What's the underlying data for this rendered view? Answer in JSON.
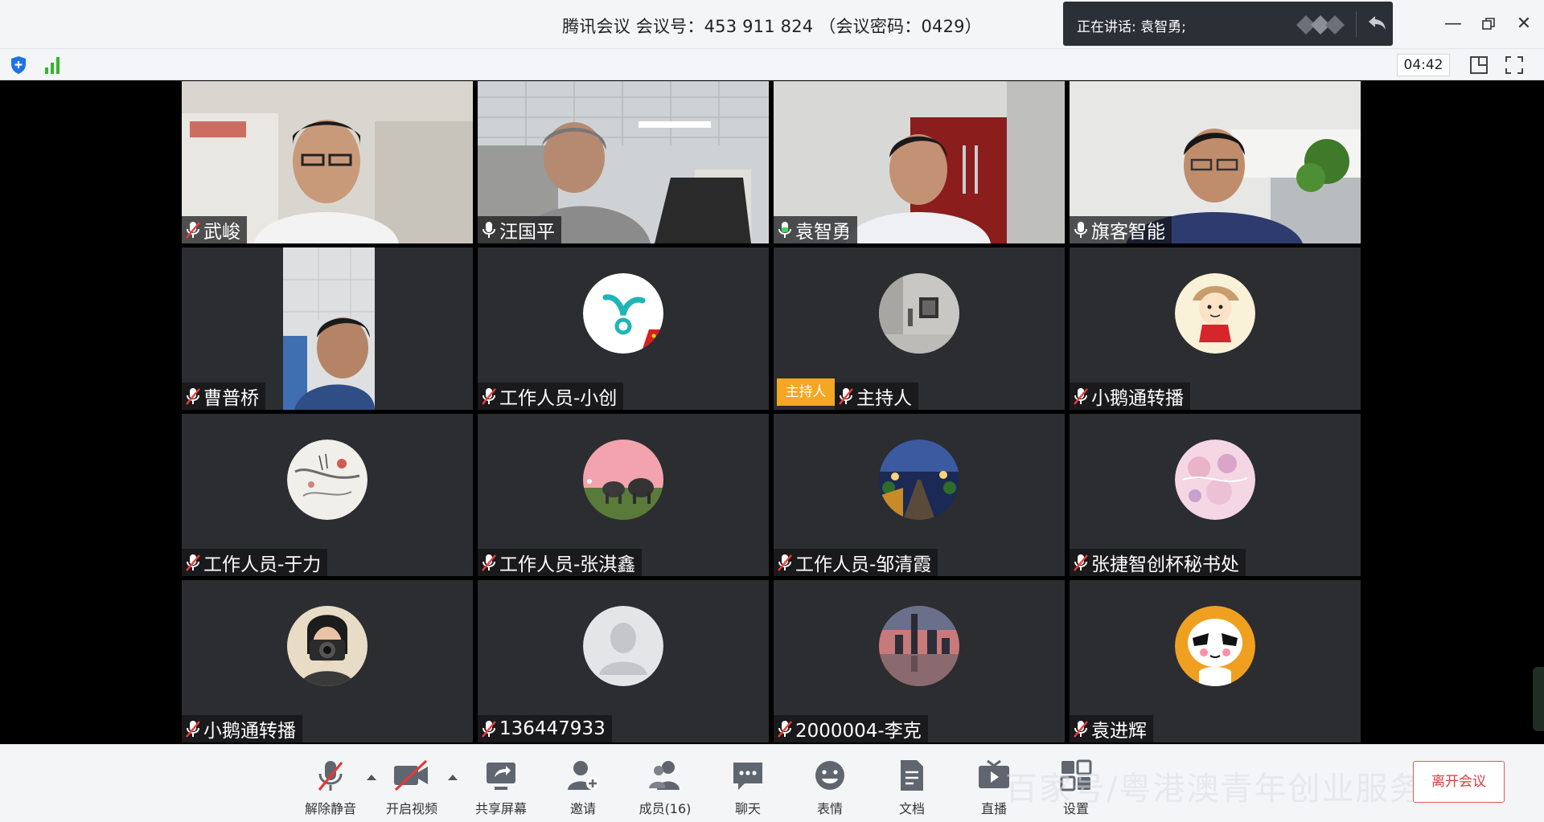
{
  "window": {
    "title": "腾讯会议 会议号：453 911 824  （会议密码：0429）",
    "speaking_label": "正在讲话: 袁智勇;"
  },
  "toolbar": {
    "timer": "04:42"
  },
  "tiles": [
    {
      "name": "武峻",
      "muted": true,
      "kind": "video",
      "scene": "office-white"
    },
    {
      "name": "汪国平",
      "muted": false,
      "kind": "video",
      "scene": "office-ceiling"
    },
    {
      "name": "袁智勇",
      "muted": false,
      "kind": "video",
      "scene": "office-red"
    },
    {
      "name": "旗客智能",
      "muted": false,
      "kind": "video",
      "scene": "office-plant"
    },
    {
      "name": "曹普桥",
      "muted": true,
      "kind": "video-portrait",
      "scene": "portrait"
    },
    {
      "name": "工作人员-小创",
      "muted": true,
      "kind": "avatar",
      "scene": "logo-teal"
    },
    {
      "name": "主持人",
      "muted": true,
      "kind": "avatar",
      "scene": "gallery",
      "host": true,
      "host_badge": "主持人"
    },
    {
      "name": "小鹅通转播",
      "muted": true,
      "kind": "avatar",
      "scene": "cartoon-girl"
    },
    {
      "name": "工作人员-于力",
      "muted": true,
      "kind": "avatar",
      "scene": "ink-painting"
    },
    {
      "name": "工作人员-张淇鑫",
      "muted": true,
      "kind": "avatar",
      "scene": "elephants"
    },
    {
      "name": "工作人员-邹清霞",
      "muted": true,
      "kind": "avatar",
      "scene": "night-road"
    },
    {
      "name": "张捷智创杯秘书处",
      "muted": true,
      "kind": "avatar",
      "scene": "pink-blossom"
    },
    {
      "name": "小鹅通转播",
      "muted": true,
      "kind": "avatar",
      "scene": "camera-girl"
    },
    {
      "name": "136447933",
      "muted": true,
      "kind": "avatar",
      "scene": "default-user"
    },
    {
      "name": "2000004-李克",
      "muted": true,
      "kind": "avatar",
      "scene": "city-dusk"
    },
    {
      "name": "袁进辉",
      "muted": true,
      "kind": "avatar",
      "scene": "panda"
    }
  ],
  "bottombar": {
    "items": [
      {
        "label": "解除静音",
        "icon": "mic-muted-icon"
      },
      {
        "label": "开启视频",
        "icon": "video-off-icon"
      },
      {
        "label": "共享屏幕",
        "icon": "share-screen-icon"
      },
      {
        "label": "邀请",
        "icon": "invite-icon"
      },
      {
        "label": "成员(16)",
        "icon": "members-icon"
      },
      {
        "label": "聊天",
        "icon": "chat-icon"
      },
      {
        "label": "表情",
        "icon": "emoji-icon"
      },
      {
        "label": "文档",
        "icon": "document-icon"
      },
      {
        "label": "直播",
        "icon": "live-icon"
      },
      {
        "label": "设置",
        "icon": "settings-icon"
      }
    ],
    "leave_label": "离开会议",
    "watermark": "百家号/粤港澳青年创业服务"
  },
  "colors": {
    "host_badge": "#f5a623",
    "leave": "#e03a3a",
    "tile_bg": "#2b2d31"
  }
}
